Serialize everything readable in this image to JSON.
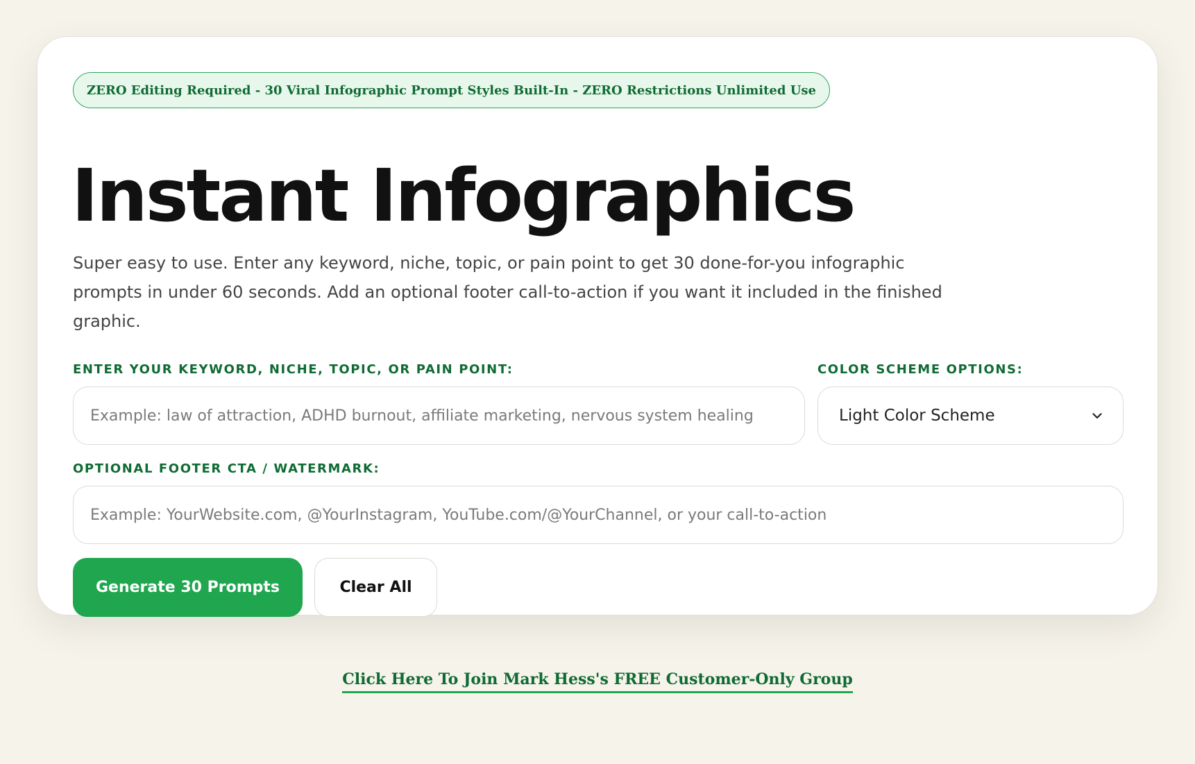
{
  "badge": {
    "text": "ZERO Editing Required - 30 Viral Infographic Prompt Styles Built-In - ZERO Restrictions Unlimited Use"
  },
  "header": {
    "title": "Instant Infographics",
    "description": "Super easy to use. Enter any keyword, niche, topic, or pain point to get 30 done-for-you infographic prompts in under 60 seconds. Add an optional footer call-to-action if you want it included in the finished graphic."
  },
  "form": {
    "keyword_label": "ENTER YOUR KEYWORD, NICHE, TOPIC, OR PAIN POINT:",
    "keyword_value": "",
    "keyword_placeholder": "Example: law of attraction, ADHD burnout, affiliate marketing, nervous system healing",
    "color_label": "COLOR SCHEME OPTIONS:",
    "color_selected": "Light Color Scheme",
    "footer_label": "OPTIONAL FOOTER CTA / WATERMARK:",
    "footer_value": "",
    "footer_placeholder": "Example: YourWebsite.com, @YourInstagram, YouTube.com/@YourChannel, or your call-to-action"
  },
  "actions": {
    "generate_label": "Generate 30 Prompts",
    "clear_label": "Clear All"
  },
  "footer": {
    "link_text": "Click Here To Join Mark Hess's FREE Customer-Only Group"
  },
  "colors": {
    "page_background": "#f6f3eb",
    "accent_green": "#1fa64f",
    "label_green": "#0f6b33",
    "badge_background": "#e8f7ec"
  },
  "icons": {
    "select_chevron": "chevron-down-icon"
  }
}
